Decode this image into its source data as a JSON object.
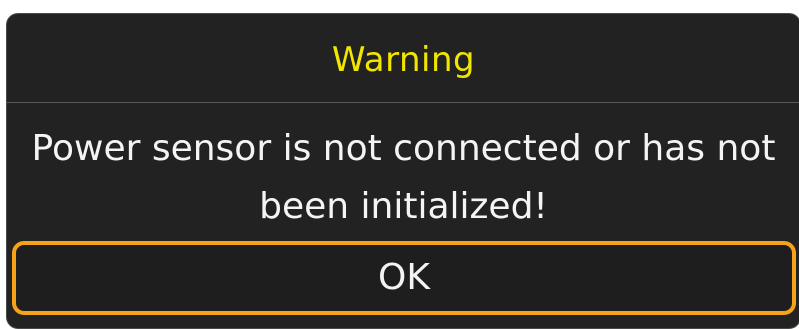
{
  "dialog": {
    "title": "Warning",
    "message_line1": "Power sensor is not connected or has not",
    "message_line2": "been initialized!",
    "ok_label": "OK"
  },
  "colors": {
    "background": "#222222",
    "title": "#f2e600",
    "text": "#f4f4f4",
    "button_border": "#f7a31a"
  }
}
